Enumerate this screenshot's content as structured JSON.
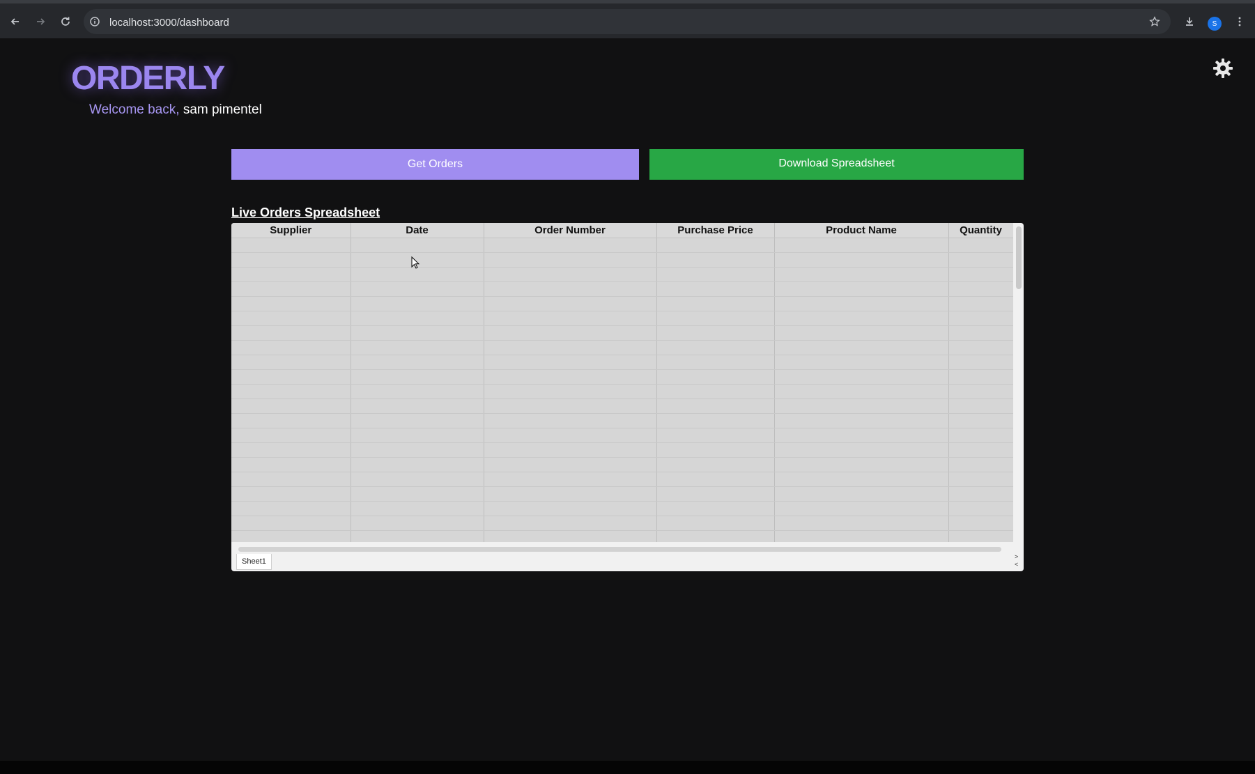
{
  "browser": {
    "url": "localhost:3000/dashboard",
    "profile_initial": "S"
  },
  "app": {
    "logo": "ORDERLY",
    "welcome_greeting": "Welcome back,",
    "user_name": "sam pimentel",
    "accent_color": "#a08df0"
  },
  "actions": {
    "get_orders_label": "Get Orders",
    "download_label": "Download Spreadsheet",
    "download_color": "#28a745"
  },
  "spreadsheet": {
    "title": "Live Orders Spreadsheet",
    "columns": [
      "Supplier",
      "Date",
      "Order Number",
      "Purchase Price",
      "Product Name",
      "Quantity"
    ],
    "rows": [],
    "sheet_tabs": [
      "Sheet1"
    ],
    "tab_nav": [
      ">",
      "<"
    ]
  }
}
